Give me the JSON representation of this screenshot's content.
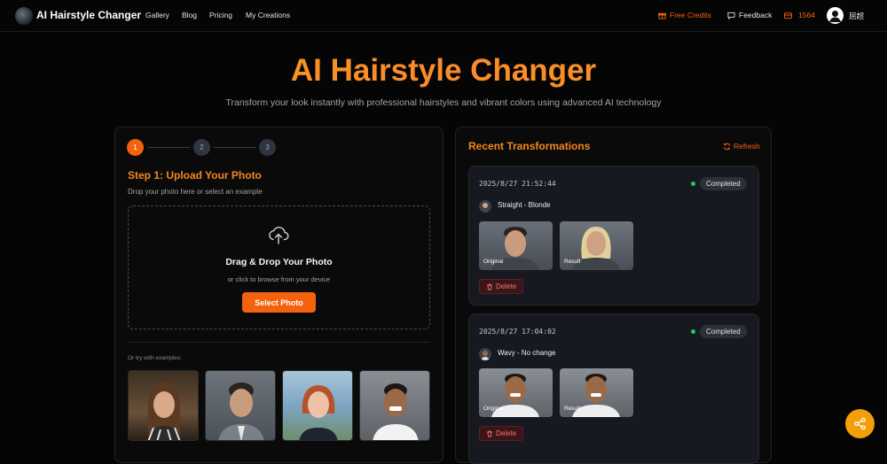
{
  "nav": {
    "brand": "AI Hairstyle Changer",
    "links": [
      "Gallery",
      "Blog",
      "Pricing",
      "My Creations"
    ],
    "free_credits": "Free Credits",
    "feedback": "Feedback",
    "credits_count": "1564",
    "username": "屈超"
  },
  "hero": {
    "title": "AI Hairstyle Changer",
    "subtitle": "Transform your look instantly with professional hairstyles and vibrant colors using advanced AI technology"
  },
  "upload": {
    "steps": [
      "1",
      "2",
      "3"
    ],
    "step_title": "Step 1: Upload Your Photo",
    "step_desc": "Drop your photo here or select an example",
    "drop_title": "Drag & Drop Your Photo",
    "drop_sub": "or click to browse from your device",
    "select_button": "Select Photo",
    "examples_label": "Or try with examples:"
  },
  "recent": {
    "title": "Recent Transformations",
    "refresh": "Refresh",
    "items": [
      {
        "timestamp": "2025/8/27 21:52:44",
        "status": "Completed",
        "style": "Straight - Blonde",
        "original_label": "Original",
        "result_label": "Result",
        "delete": "Delete"
      },
      {
        "timestamp": "2025/8/27 17:04:02",
        "status": "Completed",
        "style": "Wavy - No change",
        "original_label": "Original",
        "result_label": "Result",
        "delete": "Delete"
      }
    ]
  },
  "colors": {
    "accent": "#f5620e",
    "title_orange": "#f7922a",
    "status_green": "#22c55e"
  },
  "icons": [
    "logo-icon",
    "gift-icon",
    "feedback-icon",
    "credits-icon",
    "upload-cloud-icon",
    "refresh-icon",
    "trash-icon",
    "share-icon"
  ]
}
